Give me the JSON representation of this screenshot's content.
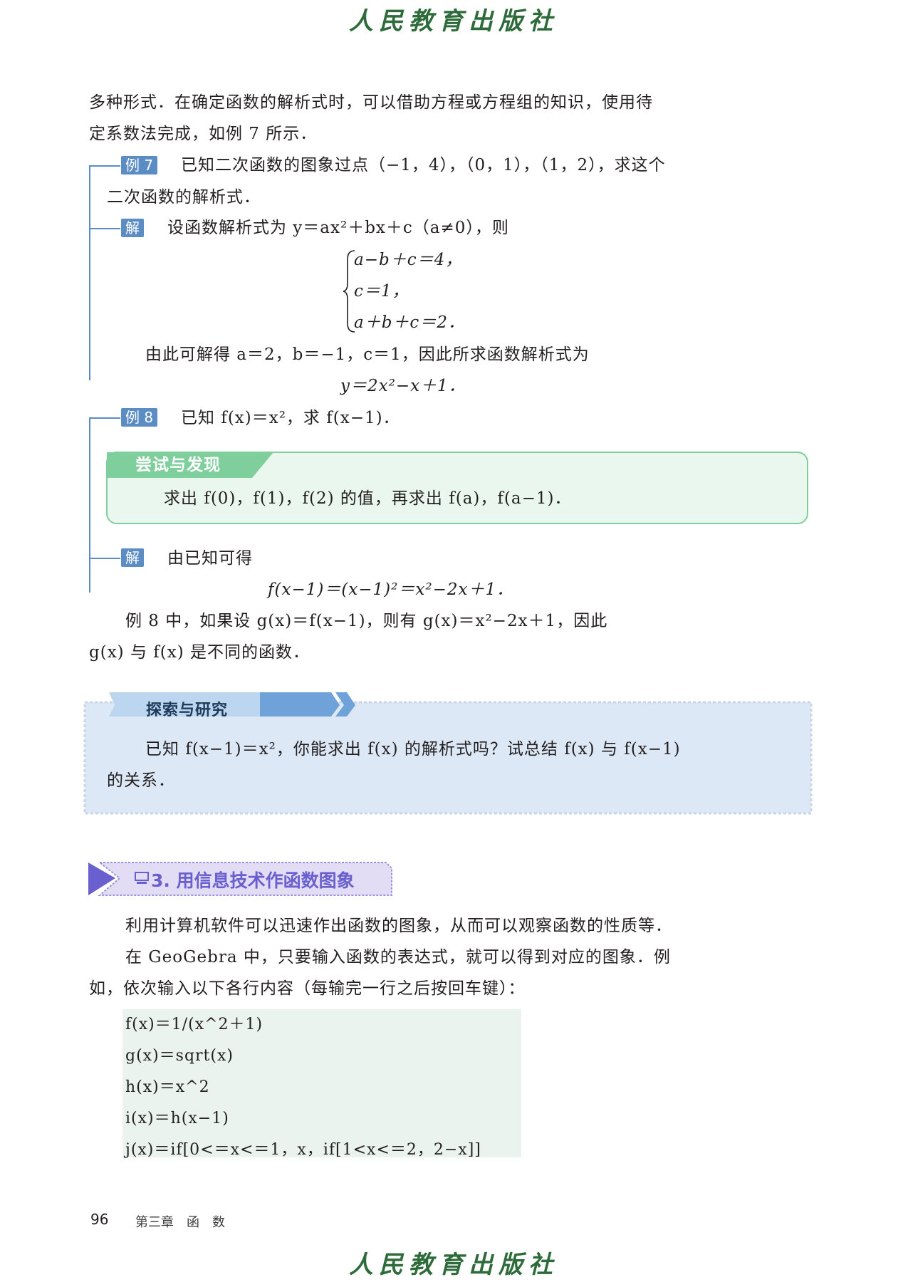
{
  "header": {
    "publisher": "人民教育出版社"
  },
  "footer": {
    "publisher": "人民教育出版社",
    "page_number": "96",
    "chapter": "第三章　函　数"
  },
  "intro": {
    "line1": "多种形式．在确定函数的解析式时，可以借助方程或方程组的知识，使用待",
    "line2": "定系数法完成，如例 7 所示．"
  },
  "example7": {
    "tag": "例 7",
    "line1": "已知二次函数的图象过点（−1，4），（0，1），（1，2），求这个",
    "line2": "二次函数的解析式．",
    "sol_tag": "解",
    "sol_line1": "设函数解析式为 y＝ax²＋bx＋c（a≠0），则",
    "system": [
      "a−b＋c＝4，",
      "c＝1，",
      "a＋b＋c＝2．"
    ],
    "result_line": "由此可解得 a＝2，b＝−1，c＝1，因此所求函数解析式为",
    "result_formula": "y＝2x²−x＋1．"
  },
  "example8": {
    "tag": "例 8",
    "line1": "已知 f(x)＝x²，求 f(x−1)．",
    "try_title": "尝试与发现",
    "try_text": "求出 f(0)，f(1)，f(2) 的值，再求出 f(a)，f(a−1)．",
    "sol_tag": "解",
    "sol_line1": "由已知可得",
    "sol_formula": "f(x−1)＝(x−1)²＝x²−2x＋1．",
    "note_line1": "例 8 中，如果设 g(x)＝f(x−1)，则有 g(x)＝x²−2x＋1，因此",
    "note_line2": "g(x) 与 f(x) 是不同的函数．"
  },
  "explore": {
    "title": "探索与研究",
    "line1": "已知 f(x−1)＝x²，你能求出 f(x) 的解析式吗？试总结 f(x) 与 f(x−1)",
    "line2": "的关系．"
  },
  "section3": {
    "title": "3. 用信息技术作函数图象",
    "p1": "利用计算机软件可以迅速作出函数的图象，从而可以观察函数的性质等．",
    "p2a": "在 GeoGebra 中，只要输入函数的表达式，就可以得到对应的图象．例",
    "p2b": "如，依次输入以下各行内容（每输完一行之后按回车键）：",
    "code": [
      "f(x)＝1/(x^2＋1)",
      "g(x)＝sqrt(x)",
      "h(x)＝x^2",
      "i(x)＝h(x−1)",
      "j(x)＝if[0<＝x<＝1，x，if[1<x<＝2，2−x]]"
    ]
  },
  "colors": {
    "accent_blue": "#5b8cc4",
    "try_green": "#7fcf9c",
    "explore_blue": "#dce8f5",
    "code_bg": "#eaf3ee"
  },
  "icons": {
    "computer": "computer-icon"
  }
}
